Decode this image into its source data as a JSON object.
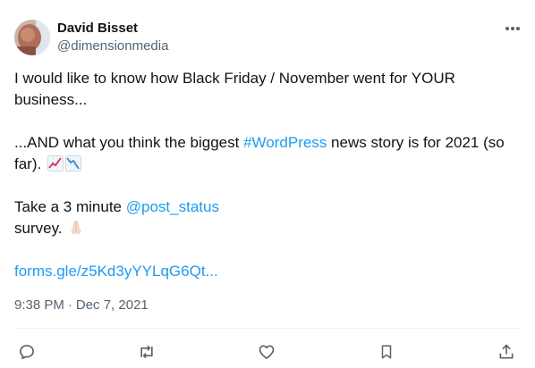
{
  "author": {
    "display_name": "David Bisset",
    "handle": "@dimensionmedia",
    "avatar_icon": "user-avatar-photo"
  },
  "menu": {
    "icon": "more-horizontal-icon"
  },
  "tweet": {
    "line1": "I would like to know how Black Friday / November went for YOUR business...",
    "line2_pre": "...AND what you think the biggest ",
    "hashtag": "#WordPress",
    "line2_post": " news story is for 2021 (so far). ",
    "emoji_chart_up": "chart-increasing-emoji",
    "emoji_chart_down": "chart-decreasing-emoji",
    "line3_pre": "Take a 3 minute ",
    "mention": "@post_status",
    "line4": "survey. ",
    "emoji_pray": "folded-hands-emoji",
    "link": "forms.gle/z5Kd3yYYLqG6Qt..."
  },
  "meta": {
    "time": "9:38 PM",
    "separator": "·",
    "date": "Dec 7, 2021"
  },
  "actions": [
    {
      "name": "reply",
      "icon": "reply-icon"
    },
    {
      "name": "retweet",
      "icon": "retweet-icon"
    },
    {
      "name": "like",
      "icon": "heart-icon"
    },
    {
      "name": "bookmark",
      "icon": "bookmark-icon"
    },
    {
      "name": "share",
      "icon": "share-icon"
    }
  ],
  "colors": {
    "link": "#1d9bf0",
    "secondary_text": "#536471",
    "primary_text": "#0f1419",
    "divider": "#eff3f4"
  }
}
